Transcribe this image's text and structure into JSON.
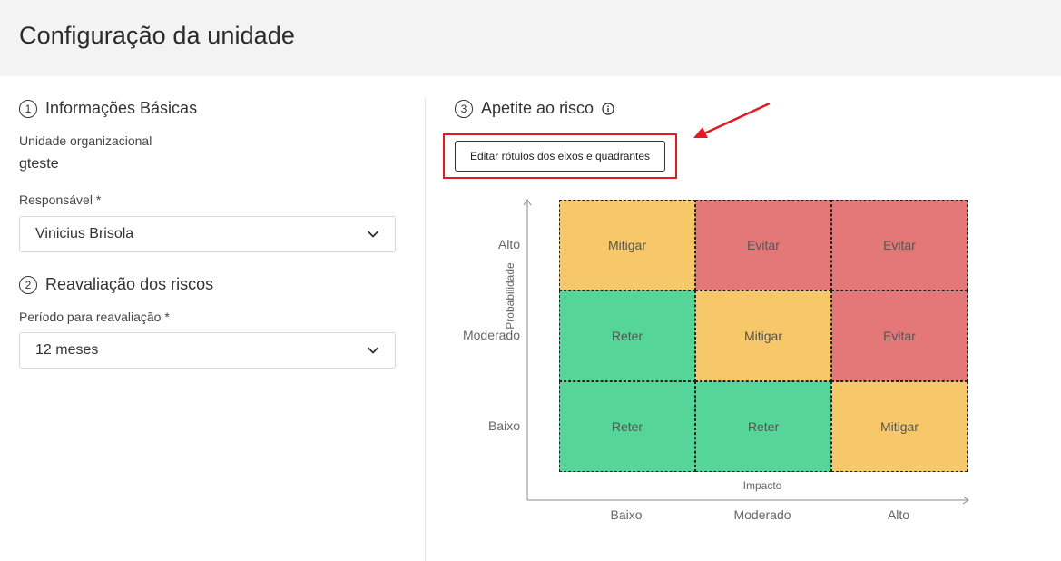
{
  "header": {
    "title": "Configuração da unidade"
  },
  "sections": {
    "basic": {
      "number": "1",
      "title": "Informações Básicas"
    },
    "reassess": {
      "number": "2",
      "title": "Reavaliação dos riscos"
    },
    "appetite": {
      "number": "3",
      "title": "Apetite ao risco"
    }
  },
  "form": {
    "org_unit_label": "Unidade organizacional",
    "org_unit_value": "gteste",
    "owner_label": "Responsável *",
    "owner_value": "Vinicius Brisola",
    "period_label": "Período para reavaliação *",
    "period_value": "12 meses"
  },
  "appetite": {
    "edit_button": "Editar rótulos dos eixos e quadrantes",
    "y_axis_title": "Probabilidade",
    "x_axis_title": "Impacto",
    "y_categories": [
      "Alto",
      "Moderado",
      "Baixo"
    ],
    "x_categories": [
      "Baixo",
      "Moderado",
      "Alto"
    ],
    "colors": {
      "mitigar": "#f6c86a",
      "evitar": "#e47878",
      "reter": "#55d597",
      "highlight": "#e01b24"
    },
    "rows": [
      [
        {
          "label": "Mitigar",
          "type": "mitigar"
        },
        {
          "label": "Evitar",
          "type": "evitar"
        },
        {
          "label": "Evitar",
          "type": "evitar"
        }
      ],
      [
        {
          "label": "Reter",
          "type": "reter"
        },
        {
          "label": "Mitigar",
          "type": "mitigar"
        },
        {
          "label": "Evitar",
          "type": "evitar"
        }
      ],
      [
        {
          "label": "Reter",
          "type": "reter"
        },
        {
          "label": "Reter",
          "type": "reter"
        },
        {
          "label": "Mitigar",
          "type": "mitigar"
        }
      ]
    ]
  },
  "icons": {
    "chevron": "chevron-down-icon",
    "info": "info-icon",
    "arrow": "annotation-arrow"
  }
}
